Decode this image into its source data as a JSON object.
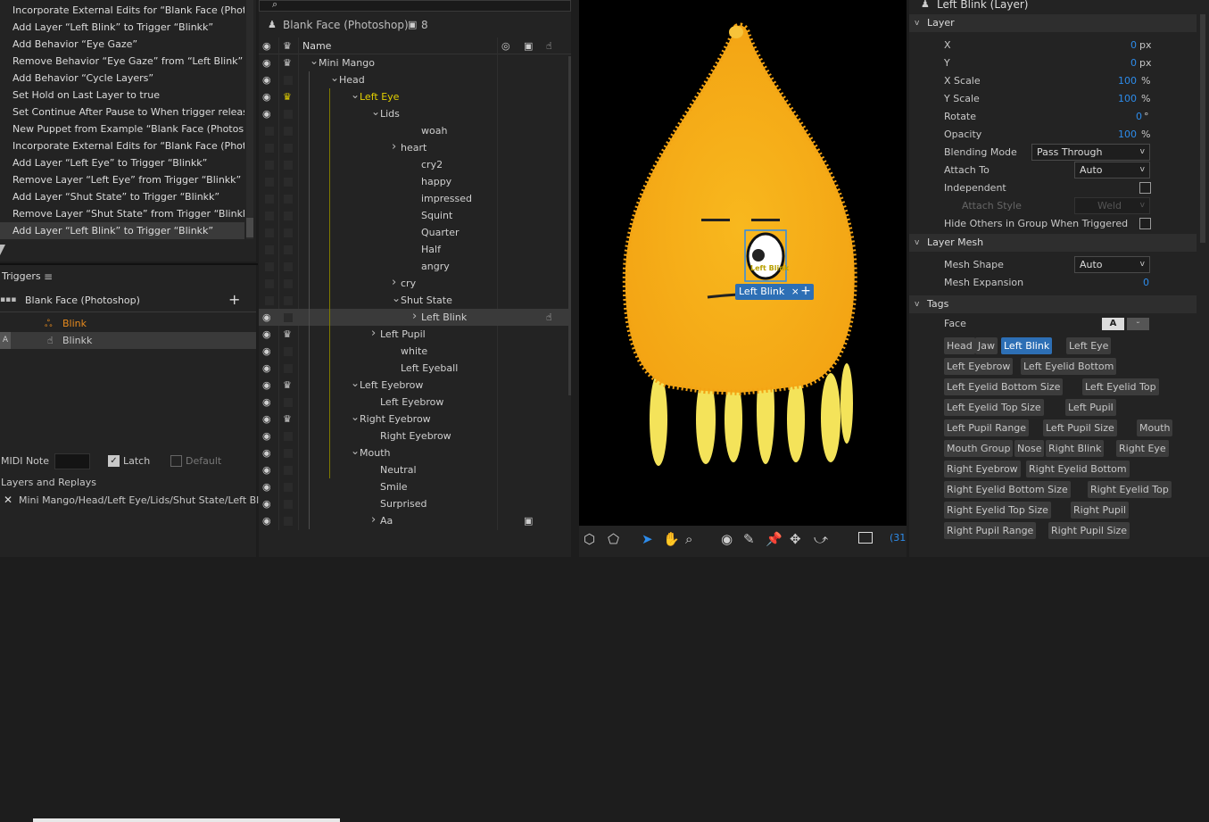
{
  "history": {
    "items": [
      "Incorporate External Edits for “Blank Face (Photoshop",
      "Add Layer “Left Blink” to Trigger “Blinkk”",
      "Add Behavior “Eye Gaze”",
      "Remove Behavior “Eye Gaze” from “Left Blink”",
      "Add Behavior “Cycle Layers”",
      "Set Hold on Last Layer to true",
      "Set Continue After Pause to When trigger released",
      "New Puppet from Example “Blank Face (Photoshop)”",
      "Incorporate External Edits for “Blank Face (Photoshop",
      "Add Layer “Left Eye” to Trigger “Blinkk”",
      "Remove Layer “Left Eye” from Trigger “Blinkk”",
      "Add Layer “Shut State” to Trigger “Blinkk”",
      "Remove Layer “Shut State” from Trigger “Blinkk”",
      "Add Layer “Left Blink” to Trigger “Blinkk”"
    ]
  },
  "triggers": {
    "title": "Triggers",
    "puppet": "Blank Face (Photoshop)",
    "add": "+",
    "items": [
      {
        "name": "Blink",
        "key": ""
      },
      {
        "name": "Blinkk",
        "key": "A"
      }
    ],
    "midi_label": "MIDI Note",
    "latch_label": "Latch",
    "default_label": "Default",
    "layers_title": "Layers and Replays",
    "layer_path": "Mini Mango/Head/Left Eye/Lids/Shut State/Left Blink"
  },
  "layers_panel": {
    "puppet_name": "Blank Face (Photoshop)",
    "count": "8",
    "col_name": "Name",
    "rows": [
      {
        "name": "Mini Mango",
        "indent": 0,
        "chev": "v",
        "eye": true,
        "crown": true
      },
      {
        "name": "Head",
        "indent": 1,
        "chev": "v",
        "eye": true,
        "crown": false
      },
      {
        "name": "Left Eye",
        "indent": 2,
        "chev": "v",
        "eye": true,
        "crown": true,
        "hl": true
      },
      {
        "name": "Lids",
        "indent": 3,
        "chev": "v",
        "eye": true,
        "crown": false
      },
      {
        "name": "woah",
        "indent": 5,
        "chev": "",
        "eye": false
      },
      {
        "name": "heart",
        "indent": 4,
        "chev": ">",
        "eye": false
      },
      {
        "name": "cry2",
        "indent": 5,
        "chev": "",
        "eye": false
      },
      {
        "name": "happy",
        "indent": 5,
        "chev": "",
        "eye": false
      },
      {
        "name": "impressed",
        "indent": 5,
        "chev": "",
        "eye": false
      },
      {
        "name": "Squint",
        "indent": 5,
        "chev": "",
        "eye": false
      },
      {
        "name": "Quarter",
        "indent": 5,
        "chev": "",
        "eye": false
      },
      {
        "name": "Half",
        "indent": 5,
        "chev": "",
        "eye": false
      },
      {
        "name": "angry",
        "indent": 5,
        "chev": "",
        "eye": false
      },
      {
        "name": "cry",
        "indent": 4,
        "chev": ">",
        "eye": false
      },
      {
        "name": "Shut State",
        "indent": 4,
        "chev": "v",
        "eye": false
      },
      {
        "name": "Left Blink",
        "indent": 5,
        "chev": ">",
        "eye": true,
        "sel": true,
        "trig": true
      },
      {
        "name": "Left Pupil",
        "indent": 3,
        "chev": ">",
        "eye": true,
        "crown": true
      },
      {
        "name": "white",
        "indent": 4,
        "chev": "",
        "eye": true
      },
      {
        "name": "Left Eyeball",
        "indent": 4,
        "chev": "",
        "eye": true
      },
      {
        "name": "Left Eyebrow",
        "indent": 2,
        "chev": "v",
        "eye": true,
        "crown": true
      },
      {
        "name": "Left Eyebrow",
        "indent": 3,
        "chev": "",
        "eye": true
      },
      {
        "name": "Right Eyebrow",
        "indent": 2,
        "chev": "v",
        "eye": true,
        "crown": true
      },
      {
        "name": "Right Eyebrow",
        "indent": 3,
        "chev": "",
        "eye": true
      },
      {
        "name": "Mouth",
        "indent": 2,
        "chev": "v",
        "eye": true
      },
      {
        "name": "Neutral",
        "indent": 3,
        "chev": "",
        "eye": true
      },
      {
        "name": "Smile",
        "indent": 3,
        "chev": "",
        "eye": true
      },
      {
        "name": "Surprised",
        "indent": 3,
        "chev": "",
        "eye": true
      },
      {
        "name": "Aa",
        "indent": 3,
        "chev": ">",
        "eye": true,
        "cam": true
      }
    ]
  },
  "canvas": {
    "tag_label": "Left Blink",
    "tag_close": "×",
    "tag_add": "+",
    "eye_text": "Left Blink",
    "zoom": "(31"
  },
  "properties": {
    "title": "Left Blink (Layer)",
    "section_layer": "Layer",
    "x_label": "X",
    "x_val": "0",
    "x_unit": "px",
    "y_label": "Y",
    "y_val": "0",
    "y_unit": "px",
    "xs_label": "X Scale",
    "xs_val": "100",
    "xs_unit": "%",
    "ys_label": "Y Scale",
    "ys_val": "100",
    "ys_unit": "%",
    "rot_label": "Rotate",
    "rot_val": "0",
    "rot_unit": "°",
    "op_label": "Opacity",
    "op_val": "100",
    "op_unit": "%",
    "blend_label": "Blending Mode",
    "blend_val": "Pass Through",
    "attach_label": "Attach To",
    "attach_val": "Auto",
    "indep_label": "Independent",
    "attach_style_label": "Attach Style",
    "attach_style_val": "Weld",
    "hide_label": "Hide Others in Group When Triggered",
    "section_mesh": "Layer Mesh",
    "mesh_shape_label": "Mesh Shape",
    "mesh_shape_val": "Auto",
    "mesh_exp_label": "Mesh Expansion",
    "mesh_exp_val": "0",
    "section_tags": "Tags",
    "face_label": "Face",
    "face_btn": "A",
    "tags": [
      [
        "Head",
        "Jaw",
        "Left Blink",
        "Left Eye"
      ],
      [
        "Left Eyebrow",
        "Left Eyelid Bottom"
      ],
      [
        "Left Eyelid Bottom Size",
        "Left Eyelid Top"
      ],
      [
        "Left Eyelid Top Size",
        "Left Pupil"
      ],
      [
        "Left Pupil Range",
        "Left Pupil Size",
        "Mouth"
      ],
      [
        "Mouth Group",
        "Nose",
        "Right Blink",
        "Right Eye"
      ],
      [
        "Right Eyebrow",
        "Right Eyelid Bottom"
      ],
      [
        "Right Eyelid Bottom Size",
        "Right Eyelid Top"
      ],
      [
        "Right Eyelid Top Size",
        "Right Pupil"
      ],
      [
        "Right Pupil Range",
        "Right Pupil Size"
      ]
    ],
    "selected_tag": "Left Blink"
  }
}
